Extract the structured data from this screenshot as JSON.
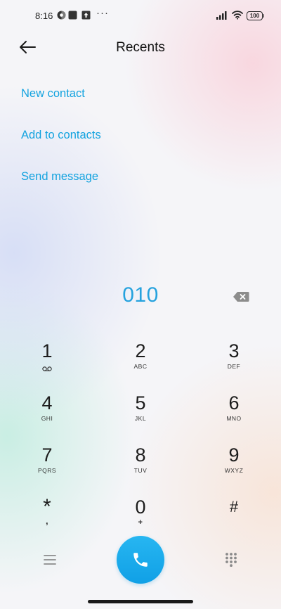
{
  "status_bar": {
    "time": "8:16",
    "battery": "100",
    "more_dots": "···"
  },
  "header": {
    "title": "Recents",
    "back_icon": "arrow-left-icon"
  },
  "actions": [
    {
      "label": "New contact"
    },
    {
      "label": "Add to contacts"
    },
    {
      "label": "Send message"
    }
  ],
  "dialer": {
    "number": "010",
    "accent_color": "#13a3df",
    "keys": [
      {
        "digit": "1",
        "letters": ""
      },
      {
        "digit": "2",
        "letters": "ABC"
      },
      {
        "digit": "3",
        "letters": "DEF"
      },
      {
        "digit": "4",
        "letters": "GHI"
      },
      {
        "digit": "5",
        "letters": "JKL"
      },
      {
        "digit": "6",
        "letters": "MNO"
      },
      {
        "digit": "7",
        "letters": "PQRS"
      },
      {
        "digit": "8",
        "letters": "TUV"
      },
      {
        "digit": "9",
        "letters": "WXYZ"
      },
      {
        "digit": "*",
        "letters": ","
      },
      {
        "digit": "0",
        "letters": "+"
      },
      {
        "digit": "#",
        "letters": ""
      }
    ]
  },
  "bottom_bar": {
    "menu_icon": "hamburger-menu-icon",
    "call_icon": "phone-icon",
    "keypad_icon": "dialpad-icon"
  }
}
